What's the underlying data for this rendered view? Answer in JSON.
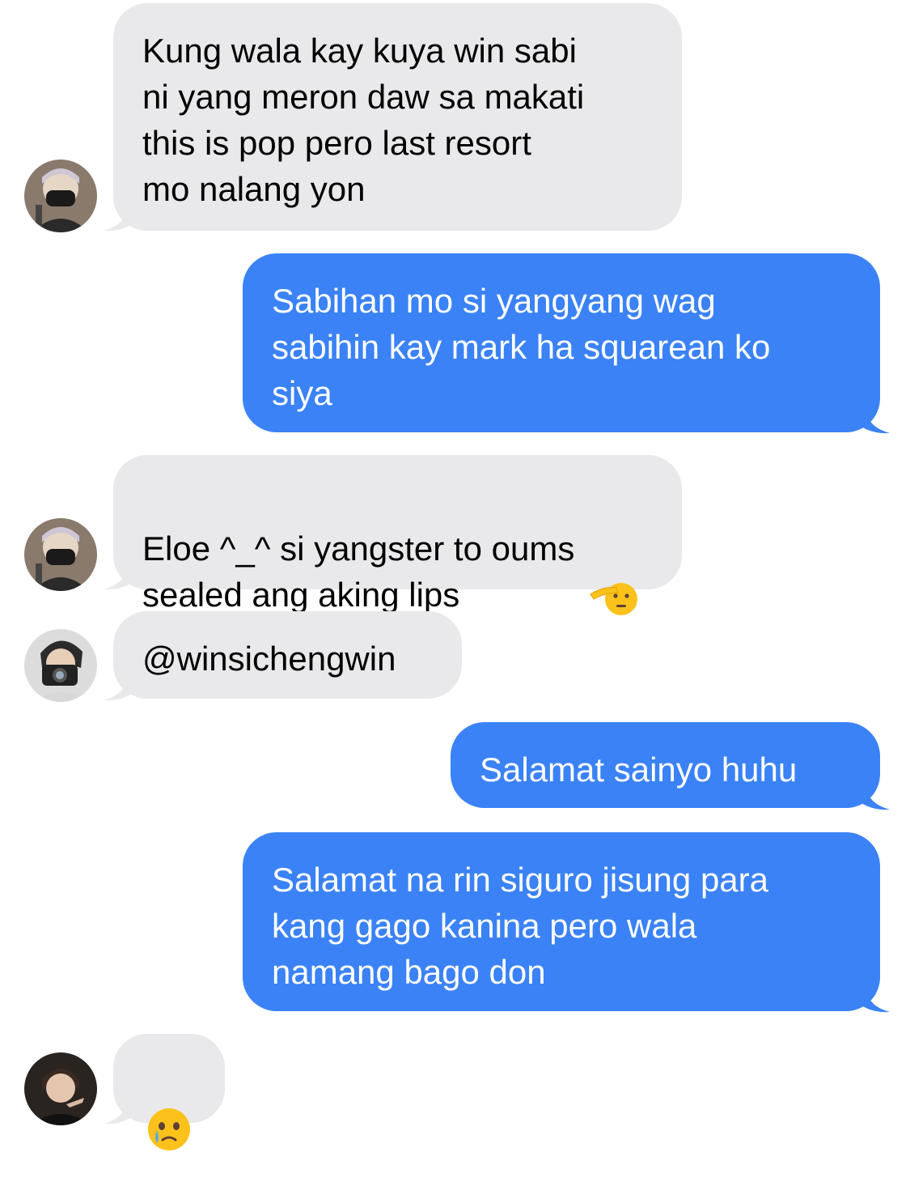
{
  "messages": [
    {
      "side": "in",
      "text": "Kung wala kay kuya win sabi\nni yang meron daw sa makati\nthis is pop pero last resort\nmo nalang yon"
    },
    {
      "side": "out",
      "text": "Sabihan mo si yangyang wag\nsabihin kay mark ha squarean ko\nsiya"
    },
    {
      "side": "in",
      "text": "Eloe ^_^ si yangster to oums\nsealed ang aking lips",
      "emoji": "saluting-face"
    },
    {
      "side": "in",
      "text": "@winsichengwin"
    },
    {
      "side": "out",
      "text": "Salamat sainyo huhu"
    },
    {
      "side": "out",
      "text": "Salamat na rin siguro jisung para\nkang gago kanina pero wala\nnamang bago don"
    },
    {
      "side": "in",
      "emoji": "face-holding-back-tears"
    }
  ],
  "colors": {
    "incoming_bubble": "#e9e9eb",
    "outgoing_bubble": "#3a82f6",
    "incoming_text": "#000000",
    "outgoing_text": "#ffffff"
  },
  "avatars": [
    {
      "icon": "contact-avatar-masked-icon"
    },
    {
      "icon": "contact-avatar-masked-icon"
    },
    {
      "icon": "contact-avatar-camera-icon"
    },
    {
      "icon": "contact-avatar-dark-icon"
    }
  ]
}
